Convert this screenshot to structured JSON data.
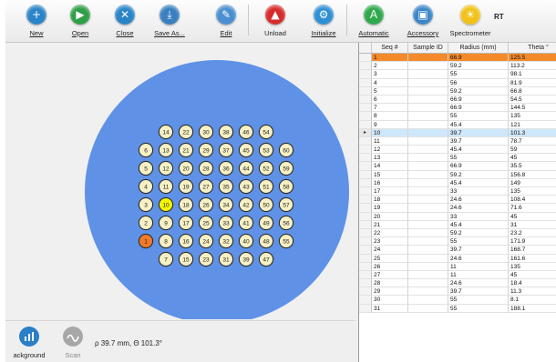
{
  "toolbar": {
    "buttons": [
      {
        "key": "new",
        "label": "New",
        "icon": "new-icon",
        "color": "#2b84c8",
        "glyph": "+"
      },
      {
        "key": "open",
        "label": "Open",
        "icon": "open-icon",
        "color": "#2f9e45",
        "glyph": "▶"
      },
      {
        "key": "close",
        "label": "Close",
        "icon": "close-icon",
        "color": "#2b84c8",
        "glyph": "✕"
      },
      {
        "key": "save_as",
        "label": "Save As...",
        "icon": "save-as-icon",
        "color": "#3a7fc0",
        "glyph": "⤓"
      },
      {
        "key": "edit",
        "label": "Edit",
        "icon": "edit-icon",
        "color": "#4a8fcf",
        "glyph": "✎"
      },
      {
        "key": "unload",
        "label": "Unload",
        "icon": "unload-icon",
        "color": "#d62b2b",
        "glyph": "▲"
      },
      {
        "key": "initialize",
        "label": "Initialize",
        "icon": "initialize-icon",
        "color": "#2f8fd4",
        "glyph": "⚙"
      },
      {
        "key": "automatic",
        "label": "Automatic",
        "icon": "automatic-icon",
        "color": "#2ea84b",
        "glyph": "A"
      },
      {
        "key": "accessory",
        "label": "Accessory",
        "icon": "accessory-icon",
        "color": "#3a86c8",
        "glyph": "▣"
      },
      {
        "key": "spectrometer",
        "label": "Spectrometer",
        "icon": "spectrometer-icon",
        "color": "#f2c21a",
        "glyph": "☀"
      }
    ],
    "rt_label": "RT"
  },
  "tray": {
    "colors": {
      "disk": "#5f92e6",
      "well": "#f7f0c4",
      "well_border": "#2b2b2b",
      "active": "#f6f500",
      "selected": "#f07a2a"
    },
    "columns": [
      {
        "wells": [
          "6",
          "5",
          "4",
          "3",
          "2",
          "1"
        ]
      },
      {
        "wells": [
          "14",
          "13",
          "12",
          "11",
          "10",
          "9",
          "8",
          "7"
        ]
      },
      {
        "wells": [
          "22",
          "21",
          "20",
          "19",
          "18",
          "17",
          "16",
          "15"
        ]
      },
      {
        "wells": [
          "30",
          "29",
          "28",
          "27",
          "26",
          "25",
          "24",
          "23"
        ]
      },
      {
        "wells": [
          "38",
          "37",
          "36",
          "35",
          "34",
          "33",
          "32",
          "31"
        ]
      },
      {
        "wells": [
          "46",
          "45",
          "44",
          "43",
          "42",
          "41",
          "40",
          "39"
        ]
      },
      {
        "wells": [
          "54",
          "53",
          "52",
          "51",
          "50",
          "49",
          "48",
          "47"
        ]
      },
      {
        "wells": [
          "60",
          "59",
          "58",
          "57",
          "56",
          "55"
        ]
      }
    ],
    "active_well": "10",
    "selected_well": "1"
  },
  "status_bar": {
    "background_label": "ackground",
    "scan_label": "Scan",
    "position_text": "ρ 39.7 mm, Θ 101.3°"
  },
  "table": {
    "headers": [
      "Seq #",
      "Sample ID",
      "Radius (mm)",
      "Theta °"
    ],
    "selected_seq": "1",
    "current_seq": "10",
    "rows": [
      {
        "seq": "1",
        "sample_id": "",
        "radius": "66.9",
        "theta": "125.5"
      },
      {
        "seq": "2",
        "sample_id": "",
        "radius": "59.2",
        "theta": "113.2"
      },
      {
        "seq": "3",
        "sample_id": "",
        "radius": "55",
        "theta": "98.1"
      },
      {
        "seq": "4",
        "sample_id": "",
        "radius": "56",
        "theta": "81.9"
      },
      {
        "seq": "5",
        "sample_id": "",
        "radius": "59.2",
        "theta": "66.8"
      },
      {
        "seq": "6",
        "sample_id": "",
        "radius": "66.9",
        "theta": "54.5"
      },
      {
        "seq": "7",
        "sample_id": "",
        "radius": "66.9",
        "theta": "144.5"
      },
      {
        "seq": "8",
        "sample_id": "",
        "radius": "55",
        "theta": "135"
      },
      {
        "seq": "9",
        "sample_id": "",
        "radius": "45.4",
        "theta": "121"
      },
      {
        "seq": "10",
        "sample_id": "",
        "radius": "39.7",
        "theta": "101.3"
      },
      {
        "seq": "11",
        "sample_id": "",
        "radius": "39.7",
        "theta": "78.7"
      },
      {
        "seq": "12",
        "sample_id": "",
        "radius": "45.4",
        "theta": "59"
      },
      {
        "seq": "13",
        "sample_id": "",
        "radius": "55",
        "theta": "45"
      },
      {
        "seq": "14",
        "sample_id": "",
        "radius": "66.9",
        "theta": "35.5"
      },
      {
        "seq": "15",
        "sample_id": "",
        "radius": "59.2",
        "theta": "156.8"
      },
      {
        "seq": "16",
        "sample_id": "",
        "radius": "45.4",
        "theta": "149"
      },
      {
        "seq": "17",
        "sample_id": "",
        "radius": "33",
        "theta": "135"
      },
      {
        "seq": "18",
        "sample_id": "",
        "radius": "24.6",
        "theta": "108.4"
      },
      {
        "seq": "19",
        "sample_id": "",
        "radius": "24.6",
        "theta": "71.6"
      },
      {
        "seq": "20",
        "sample_id": "",
        "radius": "33",
        "theta": "45"
      },
      {
        "seq": "21",
        "sample_id": "",
        "radius": "45.4",
        "theta": "31"
      },
      {
        "seq": "22",
        "sample_id": "",
        "radius": "59.2",
        "theta": "23.2"
      },
      {
        "seq": "23",
        "sample_id": "",
        "radius": "55",
        "theta": "171.9"
      },
      {
        "seq": "24",
        "sample_id": "",
        "radius": "39.7",
        "theta": "168.7"
      },
      {
        "seq": "25",
        "sample_id": "",
        "radius": "24.6",
        "theta": "161.6"
      },
      {
        "seq": "26",
        "sample_id": "",
        "radius": "11",
        "theta": "135"
      },
      {
        "seq": "27",
        "sample_id": "",
        "radius": "11",
        "theta": "45"
      },
      {
        "seq": "28",
        "sample_id": "",
        "radius": "24.6",
        "theta": "18.4"
      },
      {
        "seq": "29",
        "sample_id": "",
        "radius": "39.7",
        "theta": "11.3"
      },
      {
        "seq": "30",
        "sample_id": "",
        "radius": "55",
        "theta": "8.1"
      },
      {
        "seq": "31",
        "sample_id": "",
        "radius": "55",
        "theta": "188.1"
      }
    ]
  }
}
